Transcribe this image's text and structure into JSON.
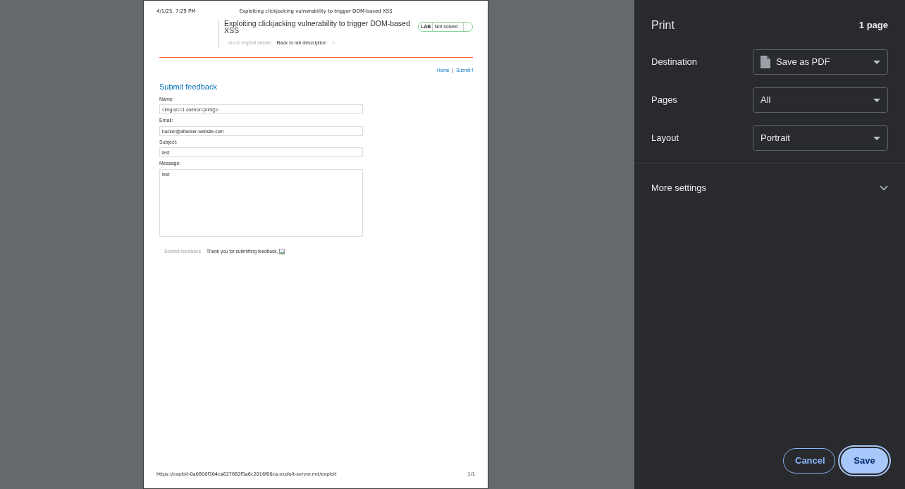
{
  "preview": {
    "header_date": "4/1/25, 7:29 PM",
    "header_title": "Exploiting clickjacking vulnerability to trigger DOM-based XSS",
    "lab": {
      "title": "Exploiting clickjacking vulnerability to trigger DOM-based XSS",
      "badge": "LAB",
      "status": "Not solved",
      "links": [
        {
          "label": "Go to exploit server",
          "disabled": true
        },
        {
          "label": "Back to lab description",
          "disabled": false
        }
      ],
      "link_arrow": "»"
    },
    "nav": [
      {
        "label": "Home"
      },
      {
        "label": "Submit f"
      }
    ],
    "nav_separator": "|",
    "heading": "Submit feedback",
    "fields": [
      {
        "label": "Name:",
        "value": "<img src=1 onerror=print()>",
        "kind": "input"
      },
      {
        "label": "Email:",
        "value": "hacker@attacker-website.com",
        "kind": "input"
      },
      {
        "label": "Subject:",
        "value": "test",
        "kind": "input"
      },
      {
        "label": "Message:",
        "value": "test",
        "kind": "textarea"
      }
    ],
    "submit_button": {
      "label": "Submit feedback",
      "disabled": true
    },
    "message": "Thank you for submitting feedback,",
    "footer_url": "https://exploit-0a0800f304ca627682f5a6c2016f00ca.exploit-server.net/exploit",
    "footer_page": "1/1"
  },
  "print_panel": {
    "title": "Print",
    "page_count": "1 page",
    "settings": [
      {
        "label": "Destination",
        "value": "Save as PDF",
        "kind": "file-select"
      },
      {
        "label": "Pages",
        "value": "All",
        "kind": "select"
      },
      {
        "label": "Layout",
        "value": "Portrait",
        "kind": "select"
      }
    ],
    "more_settings": {
      "label": "More settings",
      "expanded": false
    },
    "buttons": [
      {
        "label": "Cancel",
        "kind": "outline"
      },
      {
        "label": "Save",
        "kind": "primary"
      }
    ]
  }
}
